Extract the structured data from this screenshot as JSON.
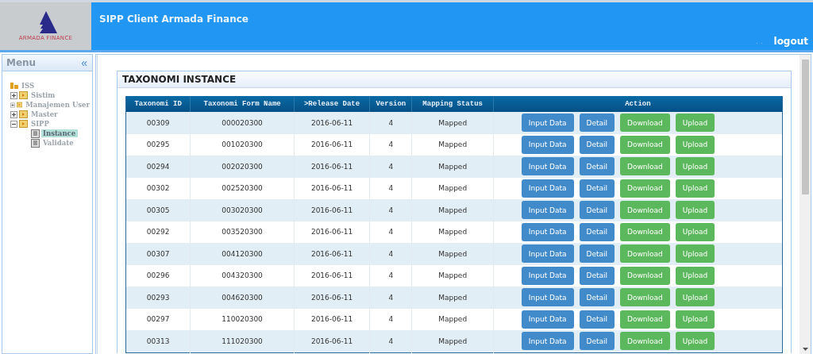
{
  "header": {
    "logo_text": "ARMADA FINANCE",
    "title": "SIPP Client Armada Finance",
    "user": ". .",
    "logout": "logout"
  },
  "sidebar": {
    "title": "Menu",
    "collapse": "«",
    "tree": [
      {
        "label": "ISS",
        "kind": "root",
        "children": [
          {
            "label": "Sistim",
            "kind": "folder",
            "expanded": false,
            "selected": false
          },
          {
            "label": "Manajemen User",
            "kind": "folder",
            "expanded": false,
            "selected": false
          },
          {
            "label": "Master",
            "kind": "folder",
            "expanded": false,
            "selected": false
          },
          {
            "label": "SIPP",
            "kind": "folder",
            "expanded": true,
            "selected": false,
            "children": [
              {
                "label": "Instance",
                "kind": "page",
                "selected": true
              },
              {
                "label": "Validate",
                "kind": "page",
                "selected": false
              }
            ]
          }
        ]
      }
    ]
  },
  "panel": {
    "title": "TAXONOMI INSTANCE"
  },
  "table": {
    "columns": [
      "Taxonomi ID",
      "Taxonomi Form Name",
      ">Release Date",
      "Version",
      "Mapping Status",
      "Action"
    ],
    "rows": [
      {
        "cells": [
          "00309",
          "000020300",
          "2016-06-11",
          "4",
          "Mapped"
        ],
        "actions": [
          {
            "label": "Input Data",
            "kind": "primary"
          },
          {
            "label": "Detail",
            "kind": "primary"
          },
          {
            "label": "Download",
            "kind": "success"
          },
          {
            "label": "Upload",
            "kind": "success"
          }
        ]
      },
      {
        "cells": [
          "00295",
          "001020300",
          "2016-06-11",
          "4",
          "Mapped"
        ],
        "actions": [
          {
            "label": "Input Data",
            "kind": "primary"
          },
          {
            "label": "Detail",
            "kind": "primary"
          },
          {
            "label": "Download",
            "kind": "success"
          },
          {
            "label": "Upload",
            "kind": "success"
          }
        ]
      },
      {
        "cells": [
          "00294",
          "002020300",
          "2016-06-11",
          "4",
          "Mapped"
        ],
        "actions": [
          {
            "label": "Input Data",
            "kind": "primary"
          },
          {
            "label": "Detail",
            "kind": "primary"
          },
          {
            "label": "Download",
            "kind": "success"
          },
          {
            "label": "Upload",
            "kind": "success"
          }
        ]
      },
      {
        "cells": [
          "00302",
          "002520300",
          "2016-06-11",
          "4",
          "Mapped"
        ],
        "actions": [
          {
            "label": "Input Data",
            "kind": "primary"
          },
          {
            "label": "Detail",
            "kind": "primary"
          },
          {
            "label": "Download",
            "kind": "success"
          },
          {
            "label": "Upload",
            "kind": "success"
          }
        ]
      },
      {
        "cells": [
          "00305",
          "003020300",
          "2016-06-11",
          "4",
          "Mapped"
        ],
        "actions": [
          {
            "label": "Input Data",
            "kind": "primary"
          },
          {
            "label": "Detail",
            "kind": "primary"
          },
          {
            "label": "Download",
            "kind": "success"
          },
          {
            "label": "Upload",
            "kind": "success"
          }
        ]
      },
      {
        "cells": [
          "00292",
          "003520300",
          "2016-06-11",
          "4",
          "Mapped"
        ],
        "actions": [
          {
            "label": "Input Data",
            "kind": "primary"
          },
          {
            "label": "Detail",
            "kind": "primary"
          },
          {
            "label": "Download",
            "kind": "success"
          },
          {
            "label": "Upload",
            "kind": "success"
          }
        ]
      },
      {
        "cells": [
          "00307",
          "004120300",
          "2016-06-11",
          "4",
          "Mapped"
        ],
        "actions": [
          {
            "label": "Input Data",
            "kind": "primary"
          },
          {
            "label": "Detail",
            "kind": "primary"
          },
          {
            "label": "Download",
            "kind": "success"
          },
          {
            "label": "Upload",
            "kind": "success"
          }
        ]
      },
      {
        "cells": [
          "00296",
          "004320300",
          "2016-06-11",
          "4",
          "Mapped"
        ],
        "actions": [
          {
            "label": "Input Data",
            "kind": "primary"
          },
          {
            "label": "Detail",
            "kind": "primary"
          },
          {
            "label": "Download",
            "kind": "success"
          },
          {
            "label": "Upload",
            "kind": "success"
          }
        ]
      },
      {
        "cells": [
          "00293",
          "004620300",
          "2016-06-11",
          "4",
          "Mapped"
        ],
        "actions": [
          {
            "label": "Input Data",
            "kind": "primary"
          },
          {
            "label": "Detail",
            "kind": "primary"
          },
          {
            "label": "Download",
            "kind": "success"
          },
          {
            "label": "Upload",
            "kind": "success"
          }
        ]
      },
      {
        "cells": [
          "00297",
          "110020300",
          "2016-06-11",
          "4",
          "Mapped"
        ],
        "actions": [
          {
            "label": "Input Data",
            "kind": "primary"
          },
          {
            "label": "Detail",
            "kind": "primary"
          },
          {
            "label": "Download",
            "kind": "success"
          },
          {
            "label": "Upload",
            "kind": "success"
          }
        ]
      },
      {
        "cells": [
          "00313",
          "111020300",
          "2016-06-11",
          "4",
          "Mapped"
        ],
        "actions": [
          {
            "label": "Input Data",
            "kind": "primary"
          },
          {
            "label": "Detail",
            "kind": "primary"
          },
          {
            "label": "Download",
            "kind": "success"
          },
          {
            "label": "Upload",
            "kind": "success"
          }
        ]
      }
    ]
  }
}
